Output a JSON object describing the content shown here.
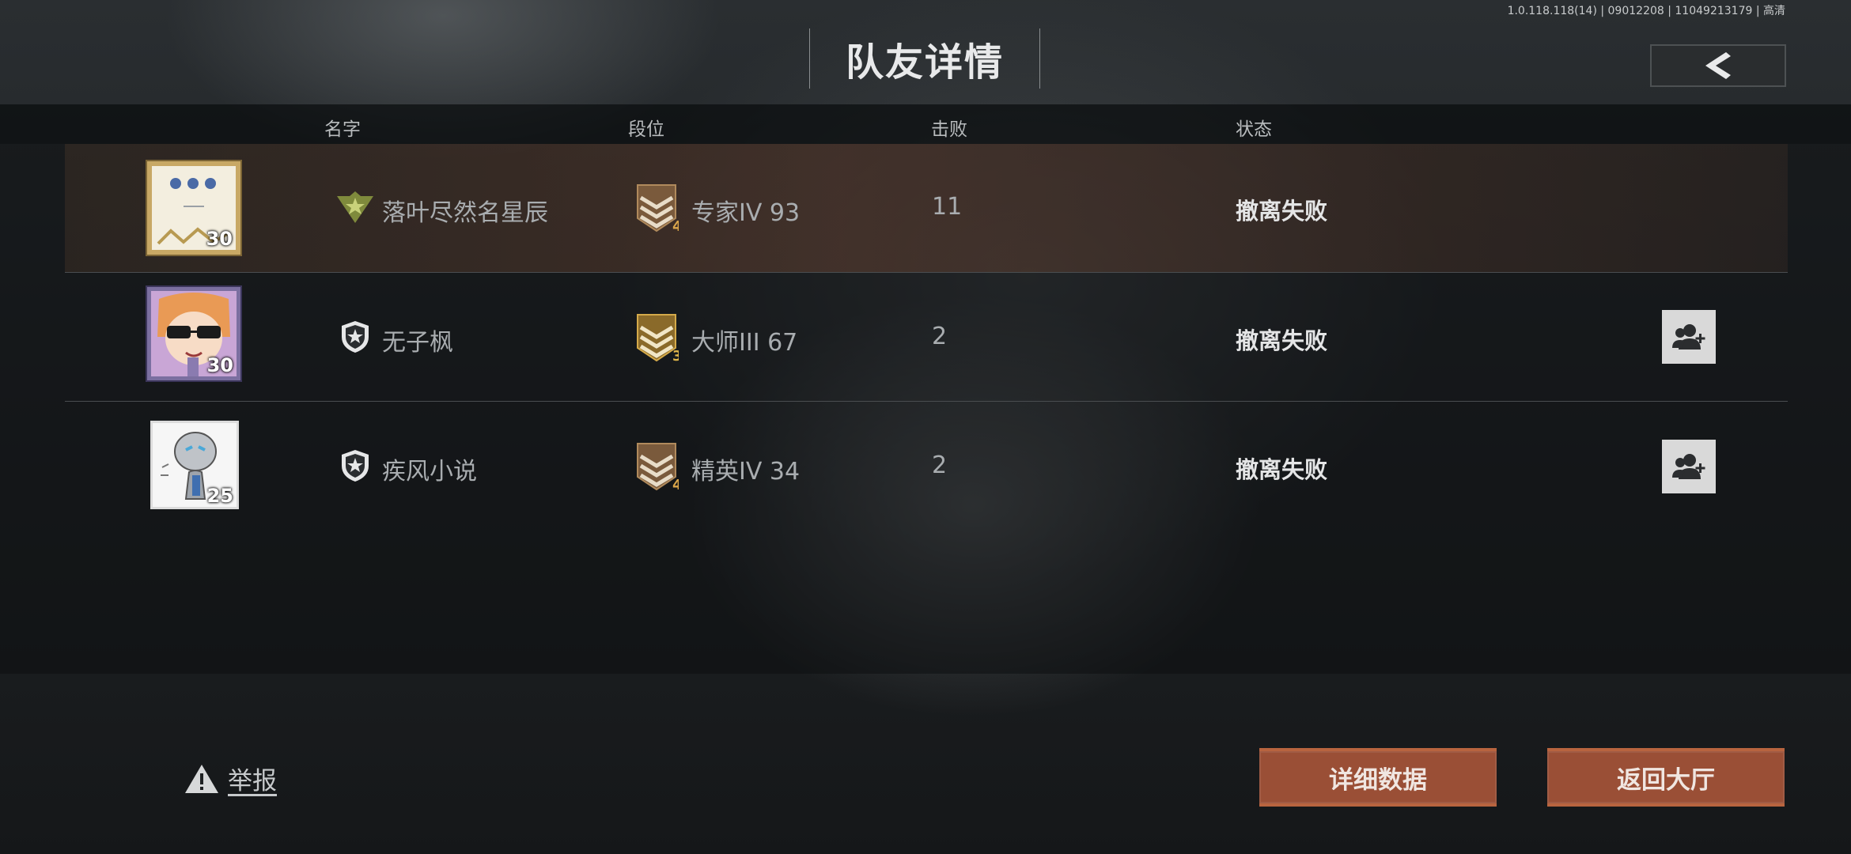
{
  "version_text": "1.0.118.118(14) | 09012208 | 11049213179 | 高清",
  "title": "队友详情",
  "columns": {
    "name": "名字",
    "rank": "段位",
    "kills": "击败",
    "status": "状态"
  },
  "players": [
    {
      "level": "30",
      "name": "落叶尽然名星辰",
      "rank": "专家IV 93",
      "rank_tier": "4",
      "kills": "11",
      "status": "撤离失败",
      "badge": "star-badge-icon",
      "show_add": false
    },
    {
      "level": "30",
      "name": "无子枫",
      "rank": "大师III 67",
      "rank_tier": "3",
      "kills": "2",
      "status": "撤离失败",
      "badge": "shield-star-icon",
      "show_add": true
    },
    {
      "level": "25",
      "name": "疾风小说",
      "rank": "精英IV 34",
      "rank_tier": "4",
      "kills": "2",
      "status": "撤离失败",
      "badge": "shield-star-icon",
      "show_add": true
    }
  ],
  "footer": {
    "report": "举报",
    "details_button": "详细数据",
    "return_button": "返回大厅"
  },
  "colors": {
    "accent_button": "#9a4f36",
    "highlight_row": "#5a3f31"
  }
}
